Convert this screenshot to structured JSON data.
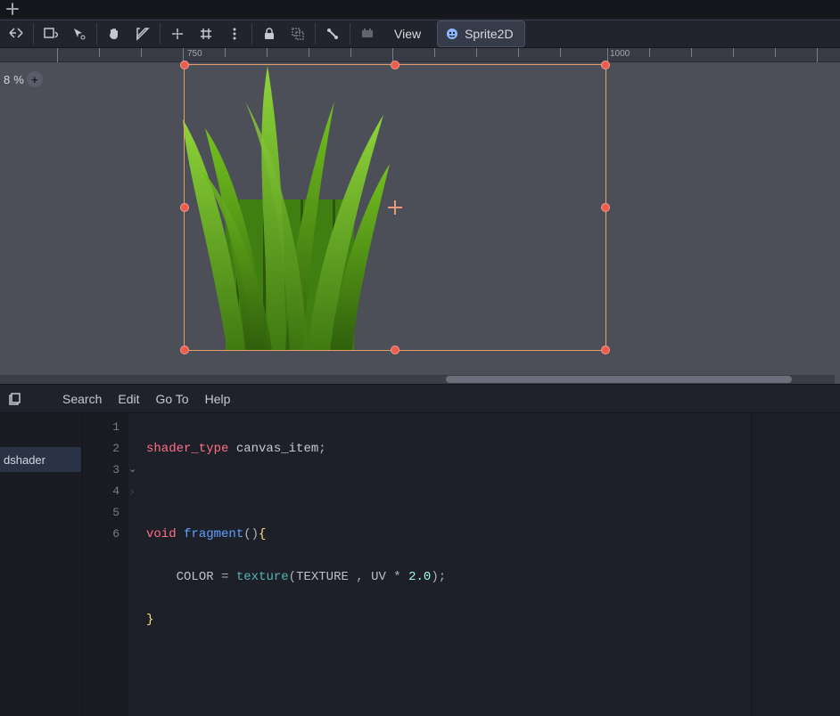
{
  "toolbar": {
    "view_label": "View",
    "node_label": "Sprite2D"
  },
  "ruler": {
    "tick_750": "750",
    "tick_1000": "1000"
  },
  "zoom": {
    "percent_suffix": " %",
    "percent_value": "8"
  },
  "editor_menu": {
    "search": "Search",
    "edit": "Edit",
    "goto": "Go To",
    "help": "Help"
  },
  "file": {
    "name": "dshader"
  },
  "code": {
    "lines": {
      "l1": "1",
      "l2": "2",
      "l3": "3",
      "l4": "4",
      "l5": "5",
      "l6": "6"
    },
    "tokens": {
      "shader_type": "shader_type",
      "canvas_item": "canvas_item",
      "semi": ";",
      "void": "void",
      "fragment": "fragment",
      "paren_open": "(",
      "paren_close": ")",
      "brace_open": "{",
      "brace_close": "}",
      "color_var": "COLOR",
      "eq": " = ",
      "texture_fn": "texture",
      "texture_var": "TEXTURE",
      "comma_sp": " , ",
      "uv_var": "UV",
      "star": " * ",
      "two": "2.0"
    }
  }
}
